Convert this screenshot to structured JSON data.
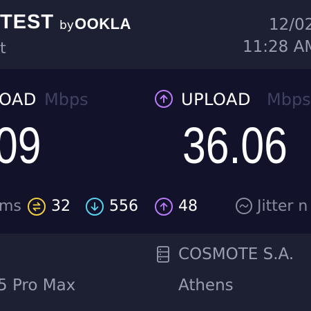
{
  "header": {
    "brand_test": "TEST",
    "brand_by": "by",
    "brand_ookla": "OOKLA",
    "subtitle_partial": "t",
    "date_partial": "12/02",
    "time_partial": "11:28 AM"
  },
  "download": {
    "label_partial": "OAD",
    "unit": "Mbps",
    "value_partial": "09"
  },
  "upload": {
    "label": "UPLOAD",
    "unit_partial": "Mbps",
    "value": "36.06"
  },
  "stats": {
    "ms_partial": "ms",
    "ping": "32",
    "download_latency": "556",
    "upload_latency": "48",
    "jitter_partial": "Jitter n"
  },
  "footer": {
    "device_partial": "5 Pro Max",
    "provider_partial": "COSMOTE S.A.",
    "location": "Athens"
  },
  "colors": {
    "ping_icon": "#f3d03e",
    "download_icon": "#59d3f0",
    "upload_icon": "#b97bf7",
    "text_gray": "#9a9caf",
    "unit_dim": "#3f4160"
  }
}
